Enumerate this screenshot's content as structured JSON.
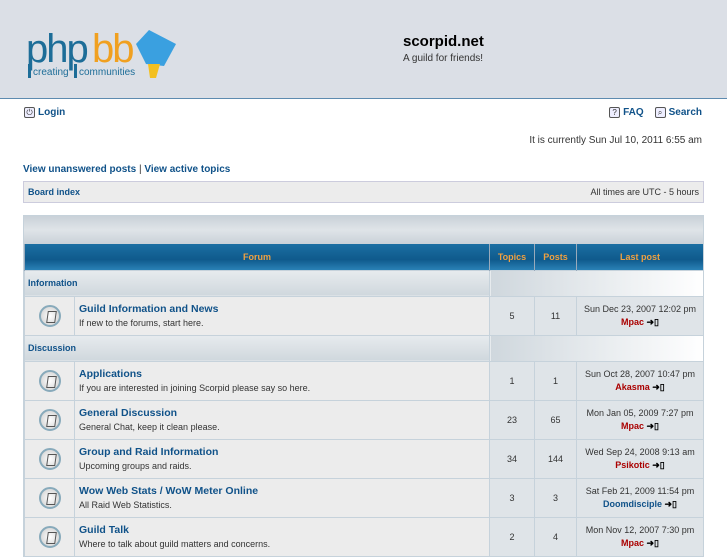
{
  "header": {
    "logo_text": "phpbb creating communities",
    "site_title": "scorpid.net",
    "site_desc": "A guild for friends!"
  },
  "nav": {
    "login": "Login",
    "faq": "FAQ",
    "search": "Search"
  },
  "time": "It is currently Sun Jul 10, 2011 6:55 am",
  "quick": {
    "unanswered": "View unanswered posts",
    "sep": " | ",
    "active": "View active topics"
  },
  "bar": {
    "board_index": "Board index",
    "timezone": "All times are UTC - 5 hours"
  },
  "columns": {
    "forum": "Forum",
    "topics": "Topics",
    "posts": "Posts",
    "last": "Last post"
  },
  "categories": [
    {
      "name": "Information",
      "forums": [
        {
          "name": "Guild Information and News",
          "desc": "If new to the forums, start here.",
          "topics": "5",
          "posts": "11",
          "date": "Sun Dec 23, 2007 12:02 pm",
          "user": "Mpac",
          "ucolor": "red"
        }
      ]
    },
    {
      "name": "Discussion",
      "forums": [
        {
          "name": "Applications",
          "desc": "If you are interested in joining Scorpid please say so here.",
          "topics": "1",
          "posts": "1",
          "date": "Sun Oct 28, 2007 10:47 pm",
          "user": "Akasma",
          "ucolor": "red"
        },
        {
          "name": "General Discussion",
          "desc": "General Chat, keep it clean please.",
          "topics": "23",
          "posts": "65",
          "date": "Mon Jan 05, 2009 7:27 pm",
          "user": "Mpac",
          "ucolor": "red"
        },
        {
          "name": "Group and Raid Information",
          "desc": "Upcoming groups and raids.",
          "topics": "34",
          "posts": "144",
          "date": "Wed Sep 24, 2008 9:13 am",
          "user": "Psikotic",
          "ucolor": "red"
        },
        {
          "name": "Wow Web Stats / WoW Meter Online",
          "desc": "All Raid Web Statistics.",
          "topics": "3",
          "posts": "3",
          "date": "Sat Feb 21, 2009 11:54 pm",
          "user": "Doomdisciple",
          "ucolor": "blue"
        },
        {
          "name": "Guild Talk",
          "desc": "Where to talk about guild matters and concerns.",
          "topics": "2",
          "posts": "4",
          "date": "Mon Nov 12, 2007 7:30 pm",
          "user": "Mpac",
          "ucolor": "red"
        }
      ]
    }
  ]
}
